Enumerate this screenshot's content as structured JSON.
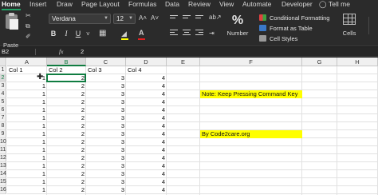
{
  "tabs": [
    "Home",
    "Insert",
    "Draw",
    "Page Layout",
    "Formulas",
    "Data",
    "Review",
    "View",
    "Automate",
    "Developer",
    "Tell me"
  ],
  "ribbon": {
    "paste_label": "Paste",
    "font_name": "Verdana",
    "font_size": "12",
    "bold": "B",
    "italic": "I",
    "underline": "U",
    "number_label": "Number",
    "number_symbol": "%",
    "conditional_formatting": "Conditional Formatting",
    "format_as_table": "Format as Table",
    "cell_styles": "Cell Styles",
    "cells_label": "Cells"
  },
  "formula_bar": {
    "cell_ref": "B2",
    "fx": "fx",
    "value": "2"
  },
  "sheet": {
    "columns": [
      "A",
      "B",
      "C",
      "D",
      "E",
      "F",
      "G",
      "H"
    ],
    "selected_column": "B",
    "rows": [
      "1",
      "2",
      "3",
      "4",
      "5",
      "6",
      "7",
      "8",
      "9",
      "10",
      "11",
      "12",
      "13",
      "14",
      "15",
      "16"
    ],
    "selected_row": "2",
    "headers": [
      "Col 1",
      "Col 2",
      "Col 3",
      "Col 4"
    ],
    "data_values": [
      "1",
      "2",
      "3",
      "4"
    ],
    "note_1": "Note: Keep Pressing Command Key",
    "note_2": "By Code2care.org"
  },
  "colors": {
    "accent": "#107c41",
    "highlight": "#ffff00",
    "ribbon_bg": "#2b2b2b"
  }
}
